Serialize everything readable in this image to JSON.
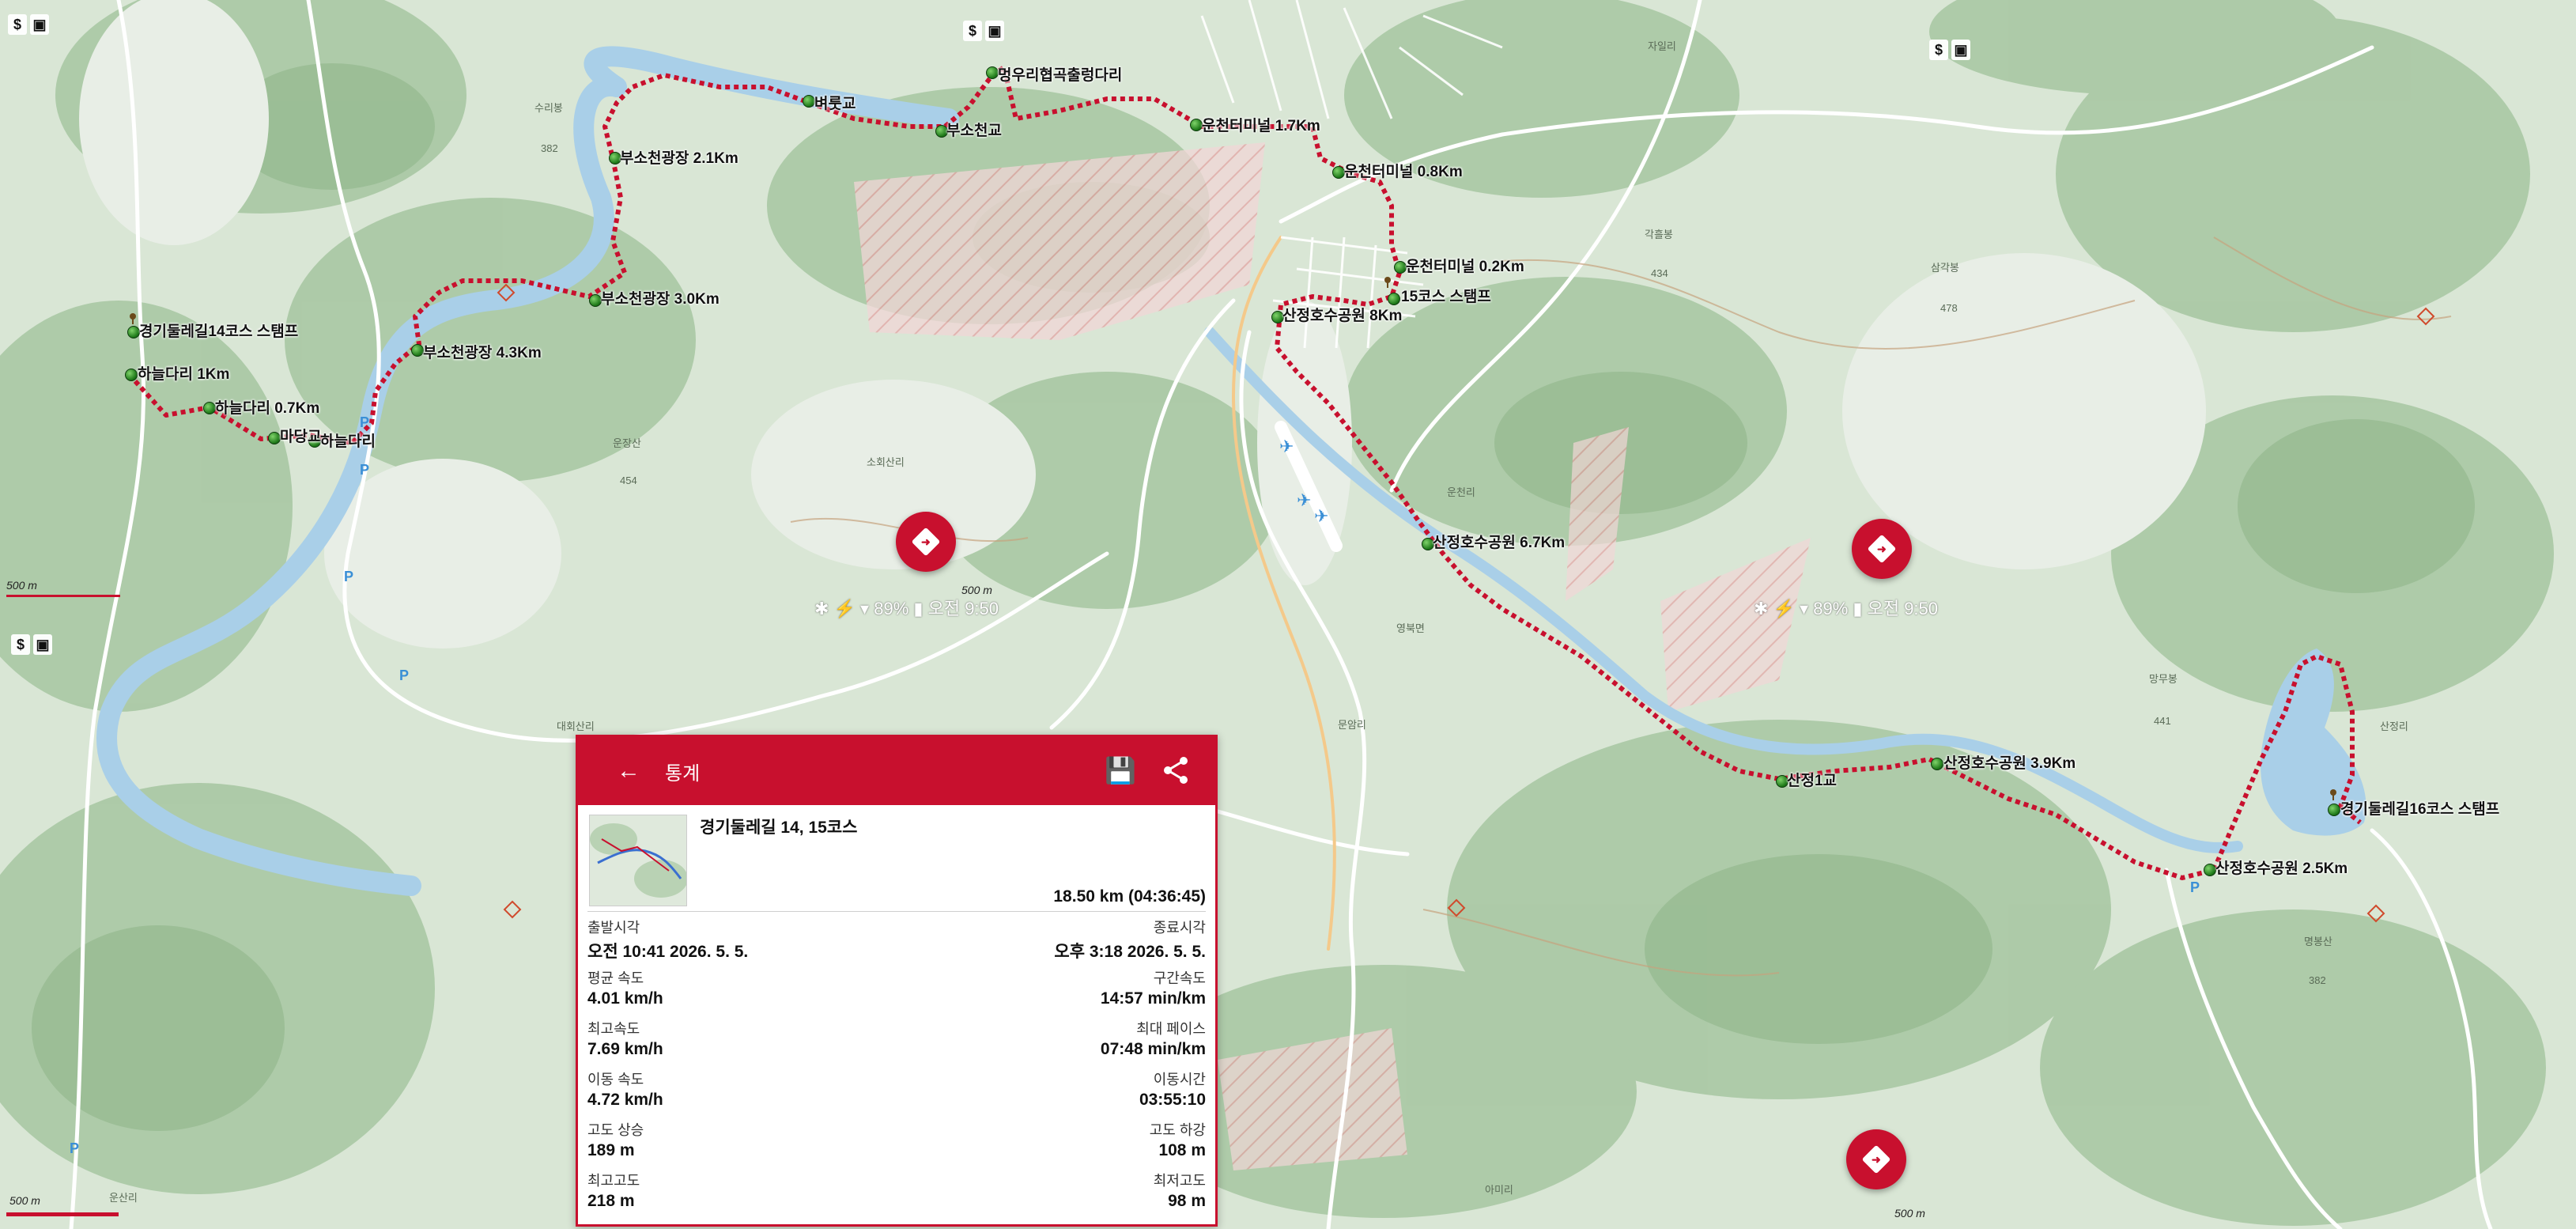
{
  "colors": {
    "accent": "#c8102e",
    "track": "#c8102e",
    "waypoint": "#2e8b22"
  },
  "status_bar": {
    "battery": "89%",
    "time": "오전 9:50"
  },
  "scale_labels": {
    "top_left": "500 m",
    "center": "500 m",
    "bottom_left": "500 m",
    "bottom_right": "500 m"
  },
  "map_labels": [
    "멍우리협곡출렁다리",
    "벼룻교",
    "부소천교",
    "운천터미널 1.7Km",
    "부소천광장 2.1Km",
    "운천터미널 0.8Km",
    "운천터미널 0.2Km",
    "15코스 스탬프",
    "산정호수공원 8Km",
    "부소천광장 3.0Km",
    "경기둘레길14코스 스탬프",
    "부소천광장 4.3Km",
    "하늘다리 1Km",
    "하늘다리 0.7Km",
    "마당교",
    "하늘다리",
    "산정호수공원 6.7Km",
    "산정1교",
    "산정호수공원 3.9Km",
    "경기둘레길16코스 스탬프",
    "산정호수공원 2.5Km"
  ],
  "place_labels": [
    "수리봉",
    "382",
    "운장산",
    "454",
    "소회산리",
    "대회산리",
    "운천리",
    "영북면",
    "문암리",
    "각흘봉",
    "434",
    "삼각봉",
    "478",
    "망무봉",
    "441",
    "산정리",
    "명봉산",
    "382",
    "아미리",
    "운산리",
    "자일리"
  ],
  "stats_panel": {
    "title": "통계",
    "back_icon": "arrow-left-icon",
    "save_icon": "save-icon",
    "share_icon": "share-icon",
    "route_name": "경기둘레길 14, 15코스",
    "distance_time": "18.50 km (04:36:45)",
    "rows": [
      {
        "left_key": "출발시각",
        "left_val": "오전 10:41 2026. 5. 5.",
        "right_key": "종료시각",
        "right_val": "오후 3:18 2026. 5. 5."
      },
      {
        "left_key": "평균 속도",
        "left_val": "4.01 km/h",
        "right_key": "구간속도",
        "right_val": "14:57 min/km"
      },
      {
        "left_key": "최고속도",
        "left_val": "7.69 km/h",
        "right_key": "최대 페이스",
        "right_val": "07:48 min/km"
      },
      {
        "left_key": "이동 속도",
        "left_val": "4.72 km/h",
        "right_key": "이동시간",
        "right_val": "03:55:10"
      },
      {
        "left_key": "고도 상승",
        "left_val": "189 m",
        "right_key": "고도 하강",
        "right_val": "108 m"
      },
      {
        "left_key": "최고고도",
        "left_val": "218 m",
        "right_key": "최저고도",
        "right_val": "98 m"
      }
    ]
  }
}
